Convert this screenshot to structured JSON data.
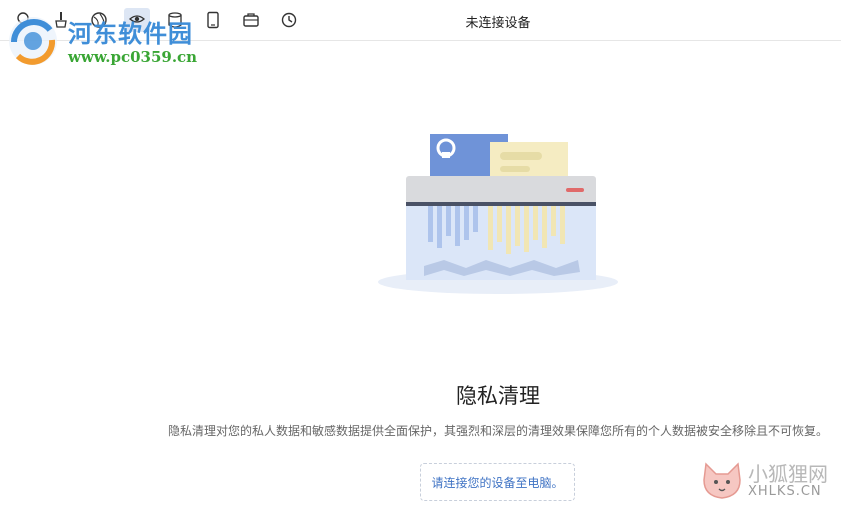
{
  "header": {
    "title": "未连接设备",
    "tools": [
      {
        "icon": "lightbulb-icon"
      },
      {
        "icon": "brush-icon"
      },
      {
        "icon": "globe-icon"
      },
      {
        "icon": "privacy-icon",
        "active": true
      },
      {
        "icon": "cylinder-icon"
      },
      {
        "icon": "tablet-icon"
      },
      {
        "icon": "briefcase-icon"
      },
      {
        "icon": "history-icon"
      }
    ]
  },
  "watermark": {
    "title": "河东软件园",
    "url": "www.pc0359.cn"
  },
  "main": {
    "heading": "隐私清理",
    "description": "隐私清理对您的私人数据和敏感数据提供全面保护，其强烈和深层的清理效果保障您所有的个人数据被安全移除且不可恢复。",
    "connect_prompt": "请连接您的设备至电脑。"
  },
  "corner_watermark": {
    "text_cn": "小狐狸网",
    "text_en": "XHLKS.CN"
  },
  "colors": {
    "accent": "#3f73c4",
    "active_tool_bg": "#dde6f4"
  }
}
